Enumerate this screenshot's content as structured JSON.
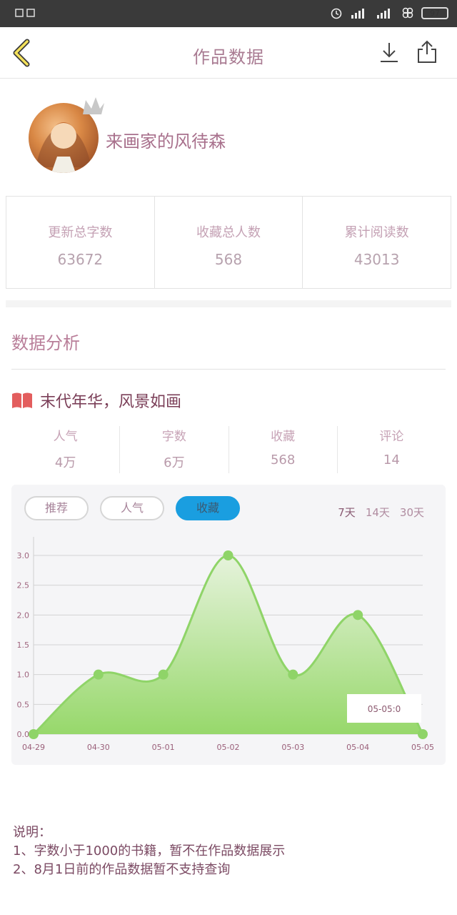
{
  "status_bar": {
    "left_text": "",
    "time": "",
    "battery": "97",
    "battery_level": 0.97
  },
  "nav": {
    "title": "作品数据"
  },
  "profile": {
    "author_name": "来画家的风待森"
  },
  "totals": [
    {
      "label": "更新总字数",
      "value": "63672"
    },
    {
      "label": "收藏总人数",
      "value": "568"
    },
    {
      "label": "累计阅读数",
      "value": "43013"
    }
  ],
  "analysis": {
    "section_title": "数据分析",
    "book_title": "末代年华，风景如画",
    "metrics": [
      {
        "label": "人气",
        "value": "4万"
      },
      {
        "label": "字数",
        "value": "6万"
      },
      {
        "label": "收藏",
        "value": "568"
      },
      {
        "label": "评论",
        "value": "14"
      }
    ],
    "chart_tabs": [
      "推荐",
      "人气",
      "收藏"
    ],
    "active_chart_tab": "收藏",
    "range_tabs": [
      "7天",
      "14天",
      "30天"
    ],
    "active_range": "7天",
    "tooltip": "05-05:0"
  },
  "chart_data": {
    "type": "area",
    "x": [
      "04-29",
      "04-30",
      "05-01",
      "05-02",
      "05-03",
      "05-04",
      "05-05"
    ],
    "values": [
      0,
      1,
      1,
      3,
      1,
      2,
      0
    ],
    "yticks": [
      "0.0",
      "0.5",
      "1.0",
      "1.5",
      "2.0",
      "2.5",
      "3.0"
    ],
    "ylim": [
      0,
      3.0
    ],
    "grid": true,
    "line_color": "#8fd468",
    "fill_top": "#e6f3dc",
    "fill_bottom": "#97d86b"
  },
  "notes": {
    "heading": "说明：",
    "items": [
      "1、字数小于1000的书籍，暂不在作品数据展示",
      "2、8月1日前的作品数据暂不支持查询"
    ]
  }
}
